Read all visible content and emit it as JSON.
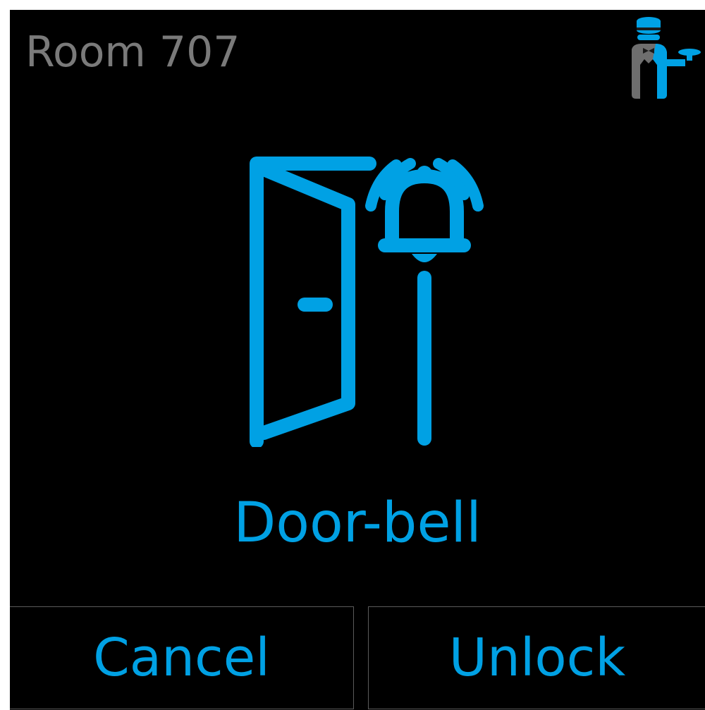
{
  "header": {
    "title": "Room 707",
    "logo_icon": "butler-icon"
  },
  "main": {
    "icon": "door-bell-icon",
    "label": "Door-bell"
  },
  "actions": {
    "cancel_label": "Cancel",
    "unlock_label": "Unlock"
  },
  "colors": {
    "accent": "#00a1e4",
    "title": "#7a7a7a",
    "background": "#000000",
    "button_border": "#5a5a5a"
  }
}
